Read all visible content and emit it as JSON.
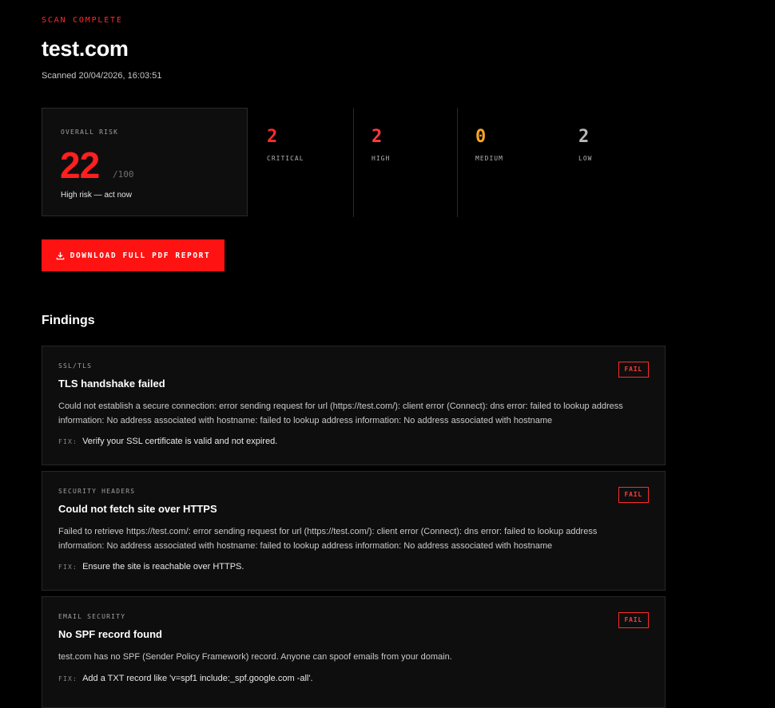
{
  "header": {
    "eyebrow": "SCAN COMPLETE",
    "domain": "test.com",
    "scanned": "Scanned 20/04/2026, 16:03:51"
  },
  "risk": {
    "label": "OVERALL RISK",
    "score": "22",
    "max": "/100",
    "message": "High risk — act now",
    "score_color": "#ff1f1f"
  },
  "stats": [
    {
      "value": "2",
      "label": "CRITICAL",
      "color": "#ff2b2b"
    },
    {
      "value": "2",
      "label": "HIGH",
      "color": "#ff3b3b"
    },
    {
      "value": "0",
      "label": "MEDIUM",
      "color": "#f5a623"
    },
    {
      "value": "2",
      "label": "LOW",
      "color": "#b8b8b8"
    }
  ],
  "download": {
    "label": "DOWNLOAD FULL PDF REPORT",
    "icon": "download-icon",
    "color": "#ff1212"
  },
  "findings": {
    "heading": "Findings",
    "fix_label": "FIX:",
    "items": [
      {
        "category": "SSL/TLS",
        "title": "TLS handshake failed",
        "status": "FAIL",
        "description": "Could not establish a secure connection: error sending request for url (https://test.com/): client error (Connect): dns error: failed to lookup address information: No address associated with hostname: failed to lookup address information: No address associated with hostname",
        "fix": "Verify your SSL certificate is valid and not expired."
      },
      {
        "category": "SECURITY HEADERS",
        "title": "Could not fetch site over HTTPS",
        "status": "FAIL",
        "description": "Failed to retrieve https://test.com/: error sending request for url (https://test.com/): client error (Connect): dns error: failed to lookup address information: No address associated with hostname: failed to lookup address information: No address associated with hostname",
        "fix": "Ensure the site is reachable over HTTPS."
      },
      {
        "category": "EMAIL SECURITY",
        "title": "No SPF record found",
        "status": "FAIL",
        "description": "test.com has no SPF (Sender Policy Framework) record. Anyone can spoof emails from your domain.",
        "fix": "Add a TXT record like 'v=spf1 include:_spf.google.com -all'."
      }
    ]
  }
}
